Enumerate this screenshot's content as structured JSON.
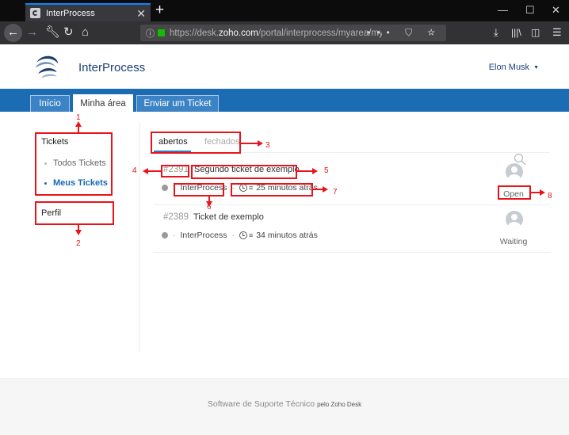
{
  "browser": {
    "tab_title": "InterProcess",
    "url_prefix": "https://desk.",
    "url_domain": "zoho.com",
    "url_path": "/portal/interprocess/myarea/myticke"
  },
  "header": {
    "brand_name": "InterProcess",
    "user_name": "Elon Musk"
  },
  "main_nav": {
    "tabs": [
      {
        "label": "Início"
      },
      {
        "label": "Minha área"
      },
      {
        "label": "Enviar um Ticket"
      }
    ],
    "active_tab": "Minha área"
  },
  "sidebar": {
    "tickets_title": "Tickets",
    "items": [
      {
        "label": "Todos Tickets"
      },
      {
        "label": "Meus Tickets"
      }
    ],
    "profile_label": "Perfil"
  },
  "status_tabs": [
    {
      "label": "abertos"
    },
    {
      "label": "fechados"
    }
  ],
  "tickets": [
    {
      "number": "#2391",
      "subject": "Segundo ticket de exemplo",
      "department": "InterProcess",
      "time_ago": "25 minutos atrás",
      "status": "Open"
    },
    {
      "number": "#2389",
      "subject": "Ticket de exemplo",
      "department": "InterProcess",
      "time_ago": "34 minutos atrás",
      "status": "Waiting"
    }
  ],
  "footer": {
    "text": "Software de Suporte Técnico",
    "powered_by": "pelo Zoho Desk"
  },
  "annotations": [
    "1",
    "2",
    "3",
    "4",
    "5",
    "6",
    "7",
    "8"
  ],
  "colors": {
    "nav_blue": "#1b6cb3",
    "brand_blue": "#1c3f7a",
    "link_blue": "#1769b5",
    "annotation_red": "#e8131b"
  }
}
